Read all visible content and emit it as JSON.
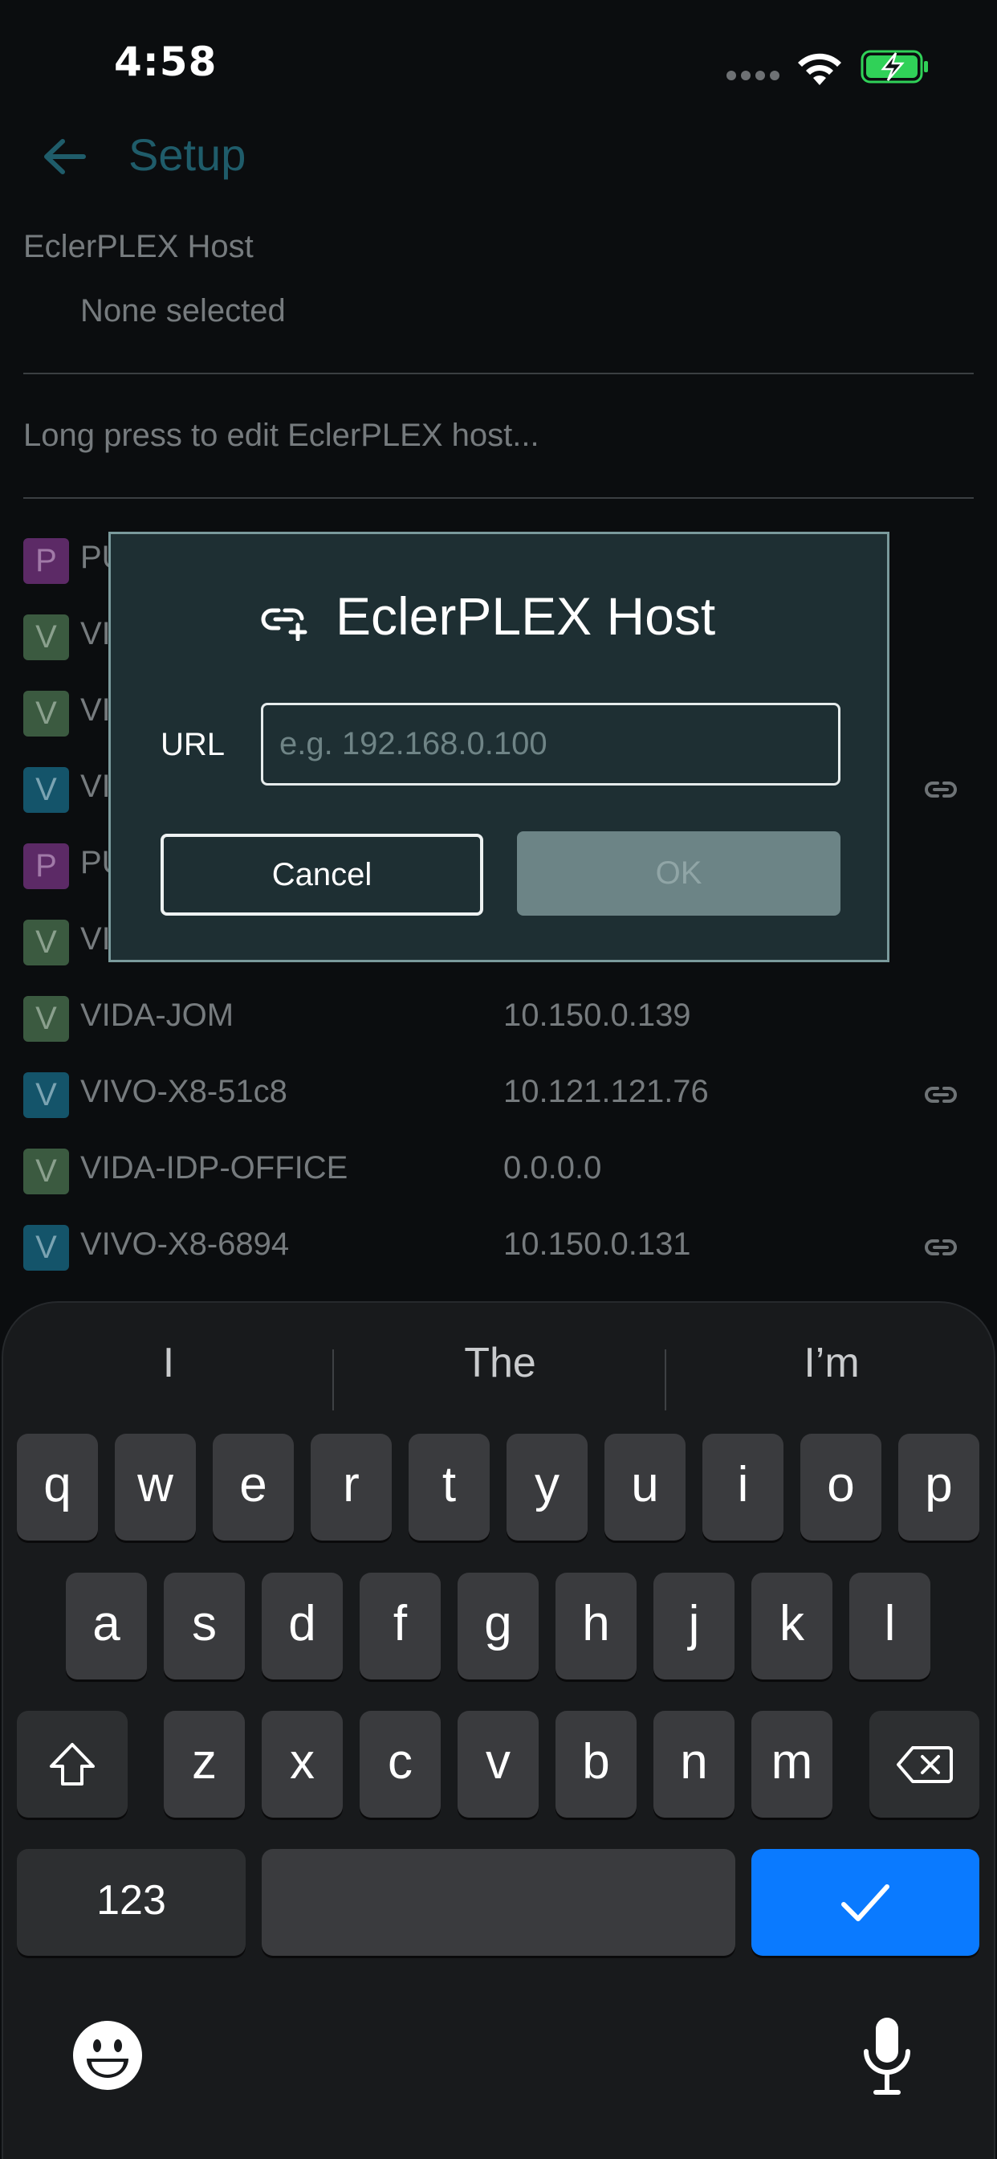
{
  "status_bar": {
    "time": "4:58"
  },
  "app_bar": {
    "title": "Setup"
  },
  "setup": {
    "host_label": "EclerPLEX Host",
    "host_value": "None selected",
    "hint": "Long press to edit EclerPLEX host..."
  },
  "devices": [
    {
      "badge": "P",
      "name": "PU",
      "ip": "",
      "linked": false
    },
    {
      "badge": "V",
      "name": "VI",
      "ip": "",
      "linked": false
    },
    {
      "badge": "V",
      "name": "VI",
      "ip": "",
      "linked": false
    },
    {
      "badge": "V",
      "name": "VI",
      "ip": "",
      "linked": true
    },
    {
      "badge": "P",
      "name": "PU",
      "ip": "",
      "linked": false
    },
    {
      "badge": "V",
      "name": "VI",
      "ip": "",
      "linked": false
    },
    {
      "badge": "V",
      "name": "VIDA-JOM",
      "ip": "10.150.0.139",
      "linked": false
    },
    {
      "badge": "V",
      "name": "VIVO-X8-51c8",
      "ip": "10.121.121.76",
      "linked": true
    },
    {
      "badge": "V",
      "name": "VIDA-IDP-OFFICE",
      "ip": "0.0.0.0",
      "linked": false
    },
    {
      "badge": "V",
      "name": "VIVO-X8-6894",
      "ip": "10.150.0.131",
      "linked": true
    }
  ],
  "dialog": {
    "title": "EclerPLEX Host",
    "url_label": "URL",
    "url_value": "",
    "url_placeholder": "e.g. 192.168.0.100",
    "cancel_label": "Cancel",
    "ok_label": "OK"
  },
  "keyboard": {
    "suggestions": [
      "I",
      "The",
      "I’m"
    ],
    "row1": [
      "q",
      "w",
      "e",
      "r",
      "t",
      "y",
      "u",
      "i",
      "o",
      "p"
    ],
    "row2": [
      "a",
      "s",
      "d",
      "f",
      "g",
      "h",
      "j",
      "k",
      "l"
    ],
    "row3": [
      "z",
      "x",
      "c",
      "v",
      "b",
      "n",
      "m"
    ],
    "numbers_label": "123"
  },
  "colors": {
    "accent_blue": "#0a7aff",
    "dialog_bg": "#1e2f33",
    "battery_green": "#30d158"
  }
}
